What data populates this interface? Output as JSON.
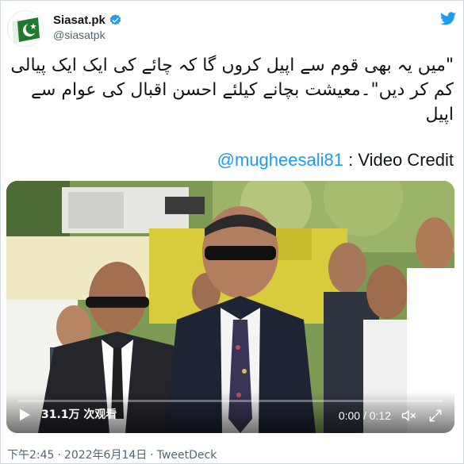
{
  "account": {
    "display_name": "Siasat.pk",
    "handle": "@siasatpk",
    "verified": true,
    "avatar_icon": "siasat-pk-flag-logo",
    "brand_color": "#1d9bf0"
  },
  "tweet": {
    "text": "\"میں یہ بھی قوم سے اپیل کروں گا کہ چائے کی ایک ایک پیالی کم کر دیں\"۔معیشت بچانے کیلئے  احسن اقبال  کی عوام سے اپیل",
    "credit_link": "@mugheesali81",
    "credit_suffix": " : Video Credit"
  },
  "video": {
    "view_count": "31.1万 次观看",
    "time": "0:00 / 0:12",
    "progress": 0,
    "play_icon": "play-icon",
    "volume_icon": "volume-icon",
    "fullscreen_icon": "fullscreen-icon"
  },
  "footer": {
    "time": "下午2:45",
    "date": "2022年6月14日",
    "separator": "·",
    "source": "TweetDeck"
  }
}
